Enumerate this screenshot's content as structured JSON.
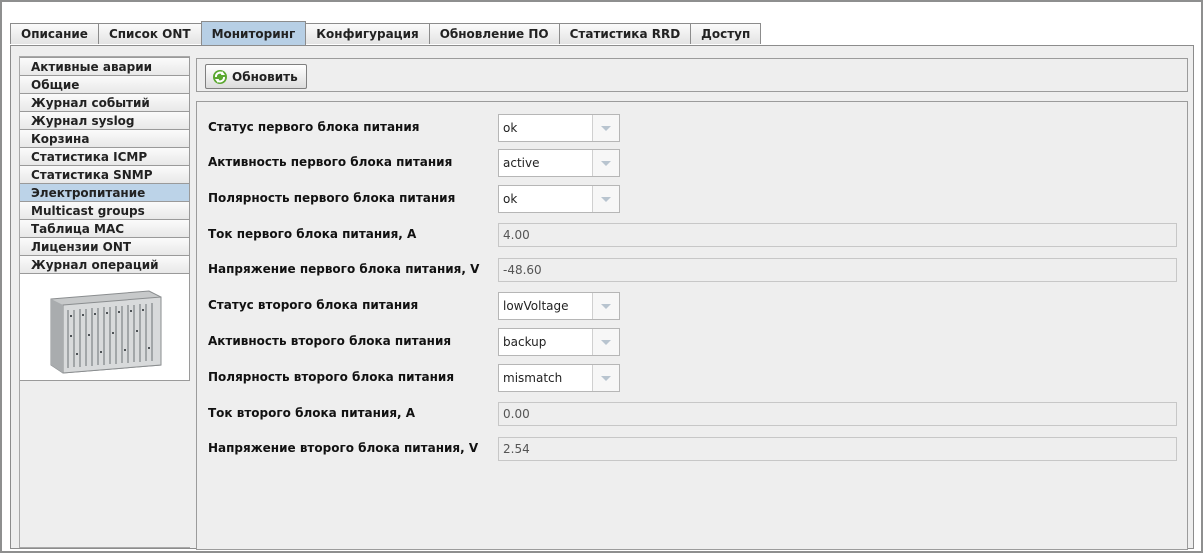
{
  "tabs": [
    "Описание",
    "Список ONT",
    "Мониторинг",
    "Конфигурация",
    "Обновление ПО",
    "Статистика RRD",
    "Доступ"
  ],
  "active_tab": "Мониторинг",
  "sidebar": {
    "items": [
      "Активные аварии",
      "Общие",
      "Журнал событий",
      "Журнал syslog",
      "Корзина",
      "Статистика ICMP",
      "Статистика SNMP",
      "Электропитание",
      "Multicast groups",
      "Таблица MAC",
      "Лицензии ONT",
      "Журнал операций"
    ],
    "active_item": "Электропитание",
    "image_icon": "device-chassis-image"
  },
  "toolbar": {
    "refresh_label": "Обновить",
    "refresh_icon": "refresh-icon"
  },
  "form": {
    "psu1_status": {
      "label": "Статус первого блока питания",
      "value": "ok"
    },
    "psu1_activity": {
      "label": "Активность первого блока питания",
      "value": "active"
    },
    "psu1_polarity": {
      "label": "Полярность первого блока питания",
      "value": "ok"
    },
    "psu1_current": {
      "label": "Ток первого блока питания, А",
      "value": "4.00"
    },
    "psu1_voltage": {
      "label": "Напряжение первого блока питания, V",
      "value": "-48.60"
    },
    "psu2_status": {
      "label": "Статус второго блока питания",
      "value": "lowVoltage"
    },
    "psu2_activity": {
      "label": "Активность второго блока питания",
      "value": "backup"
    },
    "psu2_polarity": {
      "label": "Полярность второго блока питания",
      "value": "mismatch"
    },
    "psu2_current": {
      "label": "Ток второго блока питания, А",
      "value": "0.00"
    },
    "psu2_voltage": {
      "label": "Напряжение второго блока питания, V",
      "value": "2.54"
    }
  },
  "colors": {
    "selected": "#b7cfe5",
    "border": "#8c8c8c",
    "panel_bg": "#eeeeee"
  }
}
